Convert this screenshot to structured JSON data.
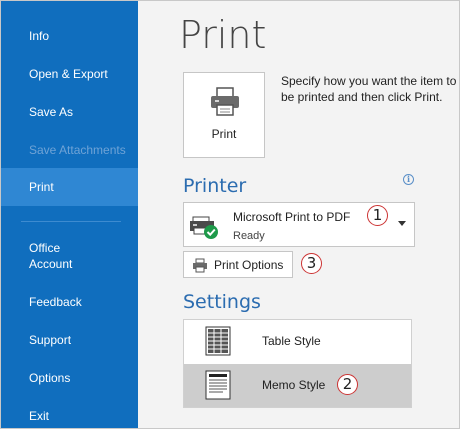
{
  "sidebar": {
    "items": [
      {
        "label": "Info"
      },
      {
        "label": "Open & Export"
      },
      {
        "label": "Save As"
      },
      {
        "label": "Save Attachments"
      },
      {
        "label": "Print"
      },
      {
        "label": "Office\nAccount"
      },
      {
        "label": "Feedback"
      },
      {
        "label": "Support"
      },
      {
        "label": "Options"
      },
      {
        "label": "Exit"
      }
    ],
    "selected": "Print",
    "disabled": "Save Attachments",
    "colors": {
      "background": "#106ebe",
      "selected": "#2f87d3",
      "disabled_text": "#6fa3d6"
    }
  },
  "main": {
    "title": "Print",
    "print_button": {
      "label": "Print",
      "icon": "printer-icon"
    },
    "print_description": "Specify how you want the item to be printed and then click Print.",
    "printer_section": {
      "title": "Printer",
      "info_icon": "info-icon",
      "info_glyph": "i",
      "selected_printer": {
        "name": "Microsoft Print to PDF",
        "status": "Ready",
        "icon": "printer-ready-icon"
      },
      "print_options_label": "Print Options"
    },
    "settings_section": {
      "title": "Settings",
      "styles": [
        {
          "label": "Table Style",
          "icon": "table-style-icon",
          "selected": false
        },
        {
          "label": "Memo Style",
          "icon": "memo-style-icon",
          "selected": true
        }
      ]
    },
    "annotations": {
      "badge_1": "1",
      "badge_2": "2",
      "badge_3": "3"
    },
    "colors": {
      "section_title": "#2b6cb0",
      "badge_border": "#cc3333",
      "selected_style": "#cdcdcd"
    }
  }
}
